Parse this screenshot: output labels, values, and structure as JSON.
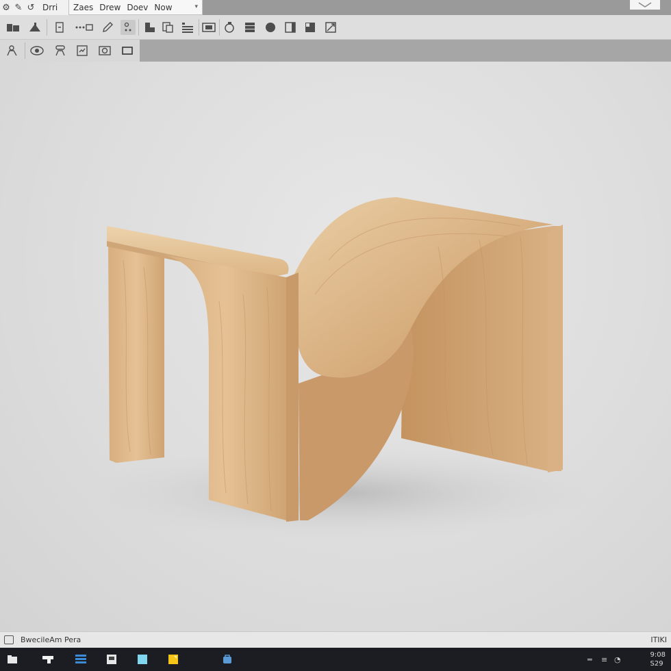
{
  "menu": {
    "app_label": "Drri",
    "items": [
      "Zaes",
      "Drew",
      "Doev",
      "Now"
    ]
  },
  "status": {
    "text": "BwecileAm Pera",
    "right": "ITIKI"
  },
  "taskbar": {
    "clock_time": "9:08",
    "clock_date": "S29"
  },
  "colors": {
    "menubar": "#9a9a9a",
    "toolbar": "#dedede",
    "canvas": "#dddddd",
    "taskbar": "#1b1d22",
    "wood_light": "#e6c79e",
    "wood_mid": "#d7ae7f",
    "wood_dark": "#b98a5c"
  },
  "icons": {
    "menubar": [
      "settings-icon",
      "pen-icon",
      "undo-icon"
    ],
    "toolbar1": [
      "folder-icon",
      "shape-icon",
      "page-icon",
      "dimension-icon",
      "pencil-icon",
      "node-icon",
      "component-icon",
      "copy-icon",
      "layers-icon",
      "image-icon",
      "rotate-icon",
      "stack-icon",
      "circle-icon",
      "panel-icon",
      "fill-icon",
      "measure-icon"
    ],
    "toolbar2": [
      "user-icon",
      "orbit-icon",
      "group-icon",
      "snap-icon",
      "camera-icon",
      "rectangle-icon"
    ],
    "taskbar": [
      "start-icon",
      "explorer-icon",
      "list-icon",
      "document-icon",
      "cyan-app-icon",
      "notes-icon",
      "store-icon"
    ]
  }
}
